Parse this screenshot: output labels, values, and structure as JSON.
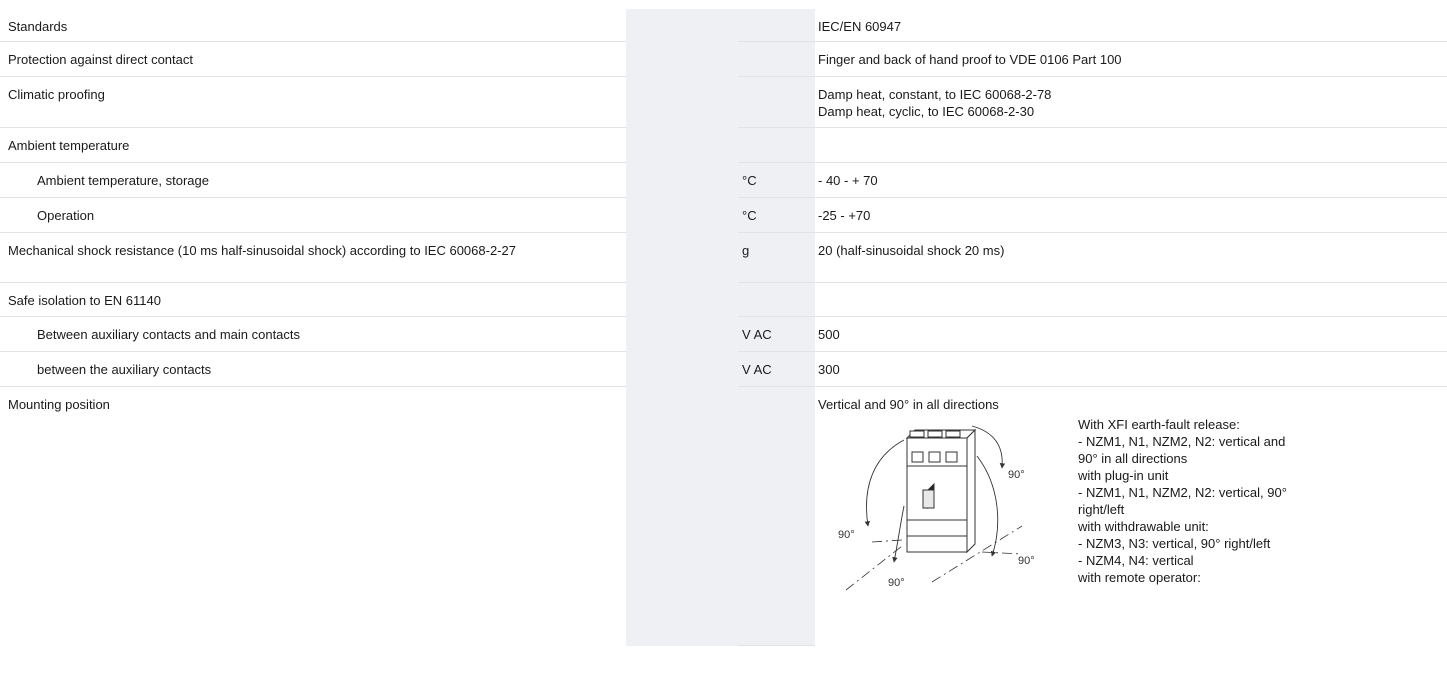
{
  "rows": [
    {
      "label": "Standards",
      "unit": "",
      "value": [
        "IEC/EN 60947"
      ]
    },
    {
      "label": "Protection against direct contact",
      "unit": "",
      "value": [
        "Finger and back of hand proof to VDE 0106 Part 100"
      ]
    },
    {
      "label": "Climatic proofing",
      "unit": "",
      "value": [
        "Damp heat, constant, to IEC 60068-2-78",
        "Damp heat, cyclic, to IEC 60068-2-30"
      ]
    },
    {
      "label": "Ambient temperature",
      "unit": "",
      "value": []
    },
    {
      "label": "Ambient temperature, storage",
      "unit": "°C",
      "value": [
        "- 40 - + 70"
      ]
    },
    {
      "label": "Operation",
      "unit": "°C",
      "value": [
        "-25 - +70"
      ]
    },
    {
      "label": "Mechanical shock resistance (10 ms half-sinusoidal shock) according to IEC 60068-2-27",
      "unit": "g",
      "value": [
        "20 (half-sinusoidal shock 20 ms)"
      ]
    },
    {
      "label": "Safe isolation to EN 61140",
      "unit": "",
      "value": []
    },
    {
      "label": "Between auxiliary contacts and main contacts",
      "unit": "V AC",
      "value": [
        "500"
      ]
    },
    {
      "label": "between the auxiliary contacts",
      "unit": "V AC",
      "value": [
        "300"
      ]
    },
    {
      "label": "Mounting position",
      "unit": "",
      "value": [
        "Vertical and 90° in all directions"
      ]
    }
  ],
  "mounting": {
    "angle_label": "90°",
    "notes": [
      "With XFI earth-fault release:",
      "- NZM1, N1, NZM2, N2: vertical and",
      "90° in all directions",
      "with plug-in unit",
      "- NZM1, N1, NZM2, N2: vertical, 90°",
      "right/left",
      "with withdrawable unit:",
      "- NZM3, N3: vertical, 90° right/left",
      "- NZM4, N4: vertical",
      "with remote operator:"
    ]
  }
}
